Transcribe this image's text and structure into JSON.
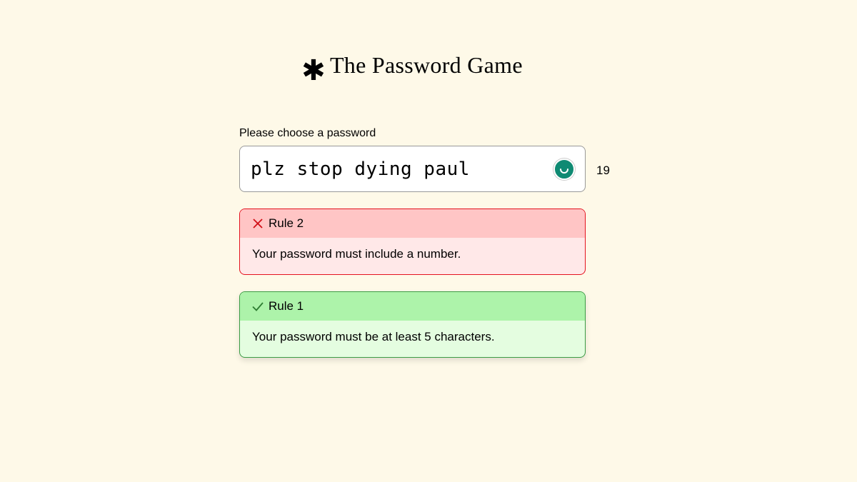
{
  "header": {
    "title": "The Password Game",
    "logo_icon": "asterisk-icon"
  },
  "password": {
    "label": "Please choose a password",
    "value": "plz stop dying paul",
    "length": "19",
    "extension_icon": "grammarly-icon"
  },
  "rules": [
    {
      "status": "fail",
      "status_icon": "x-icon",
      "title": "Rule 2",
      "description": "Your password must include a number.",
      "colors": {
        "border": "#e4131f",
        "header": "#ffc5c5",
        "body": "#ffe8e8"
      }
    },
    {
      "status": "pass",
      "status_icon": "check-icon",
      "title": "Rule 1",
      "description": "Your password must be at least 5 characters.",
      "colors": {
        "border": "#3c9b45",
        "header": "#adf3aa",
        "body": "#e4fde0"
      }
    }
  ],
  "colors": {
    "background": "#fef9e8",
    "grammarly": "#0f8a73"
  }
}
